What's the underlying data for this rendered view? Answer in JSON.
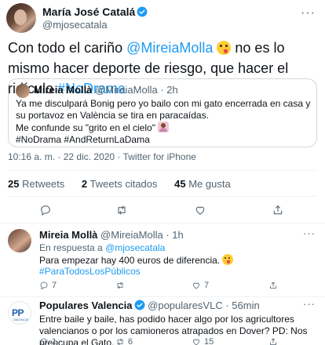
{
  "author": {
    "name": "María José Catalá",
    "handle": "@mjosecatala"
  },
  "tweet": {
    "text_before": "Con todo el cariño ",
    "mention": "@MireiaMolla",
    "text_middle": " no es lo mismo hacer deporte de riesgo, que hacer el ridículo ",
    "hashtag": "#NoDrama"
  },
  "quote": {
    "name": "Mireia Mollà",
    "handle": "@MireiaMolla",
    "time": "· 2h",
    "line1": "Ya me disculpará Bonig pero yo bailo con mi gato encerrada en casa y su portavoz en València se tira en paracaídas.",
    "line2": "Me confunde su \"grito en el cielo\"",
    "line3": "#NoDrama #AndReturnLaDama"
  },
  "meta": {
    "time": "10:16 a. m.",
    "sep1": " · ",
    "date": "22 dic. 2020",
    "sep2": " · ",
    "source": "Twitter for iPhone"
  },
  "stats": {
    "retweets_count": "25",
    "retweets_label": " Retweets",
    "quotes_count": "2",
    "quotes_label": " Tweets citados",
    "likes_count": "45",
    "likes_label": " Me gusta"
  },
  "actions": {
    "reply_icon": "reply-icon",
    "retweet_icon": "retweet-icon",
    "like_icon": "like-icon",
    "share_icon": "share-icon"
  },
  "replies": [
    {
      "name": "Mireia Mollà",
      "handle": "@MireiaMolla",
      "time": "· 1h",
      "reply_prefix": "En respuesta a ",
      "reply_to": "@mjosecatala",
      "text": "Para empezar hay 400 euros de diferencia.",
      "tag": "#ParaTodosLosPúblicos",
      "reply_count": "7",
      "retweet_count": "",
      "like_count": "7"
    },
    {
      "name": "Populares Valencia",
      "handle": "@popularesVLC",
      "time": "· 56min",
      "text": "Entre baile y baile, has podido hacer algo por los agricultores valencianos o por los camioneros atrapados en Dover? PD: Nos preocupa el Gato.",
      "logo_text": "PP",
      "logo_sub": "VALENCIA",
      "reply_count": "1",
      "retweet_count": "6",
      "like_count": "15"
    }
  ],
  "colors": {
    "link": "#1d9bf0",
    "verified": "#1d9bf0",
    "muted": "#536471"
  }
}
